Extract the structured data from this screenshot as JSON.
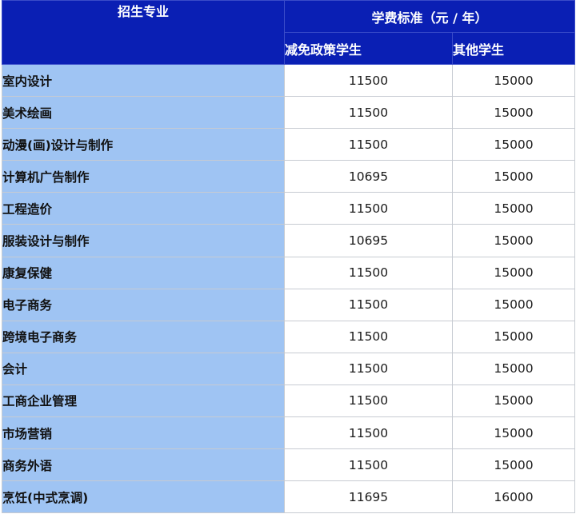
{
  "table": {
    "header": {
      "major": "招生专业",
      "fee_standard": "学费标准（元 / 年）",
      "policy_students": "减免政策学生",
      "other_students": "其他学生"
    },
    "rows": [
      {
        "major": "室内设计",
        "policy_fee": "11500",
        "other_fee": "15000"
      },
      {
        "major": "美术绘画",
        "policy_fee": "11500",
        "other_fee": "15000"
      },
      {
        "major": "动漫(画)设计与制作",
        "policy_fee": "11500",
        "other_fee": "15000"
      },
      {
        "major": "计算机广告制作",
        "policy_fee": "10695",
        "other_fee": "15000"
      },
      {
        "major": "工程造价",
        "policy_fee": "11500",
        "other_fee": "15000"
      },
      {
        "major": "服装设计与制作",
        "policy_fee": "10695",
        "other_fee": "15000"
      },
      {
        "major": "康复保健",
        "policy_fee": "11500",
        "other_fee": "15000"
      },
      {
        "major": "电子商务",
        "policy_fee": "11500",
        "other_fee": "15000"
      },
      {
        "major": "跨境电子商务",
        "policy_fee": "11500",
        "other_fee": "15000"
      },
      {
        "major": "会计",
        "policy_fee": "11500",
        "other_fee": "15000"
      },
      {
        "major": "工商企业管理",
        "policy_fee": "11500",
        "other_fee": "15000"
      },
      {
        "major": "市场营销",
        "policy_fee": "11500",
        "other_fee": "15000"
      },
      {
        "major": "商务外语",
        "policy_fee": "11500",
        "other_fee": "15000"
      },
      {
        "major": "烹饪(中式烹调)",
        "policy_fee": "11695",
        "other_fee": "16000"
      }
    ]
  },
  "colors": {
    "header_bg": "#0a1fb4",
    "major_col_bg": "#9fc4f3",
    "cell_bg": "#ffffff",
    "border": "#c7cbd2"
  }
}
